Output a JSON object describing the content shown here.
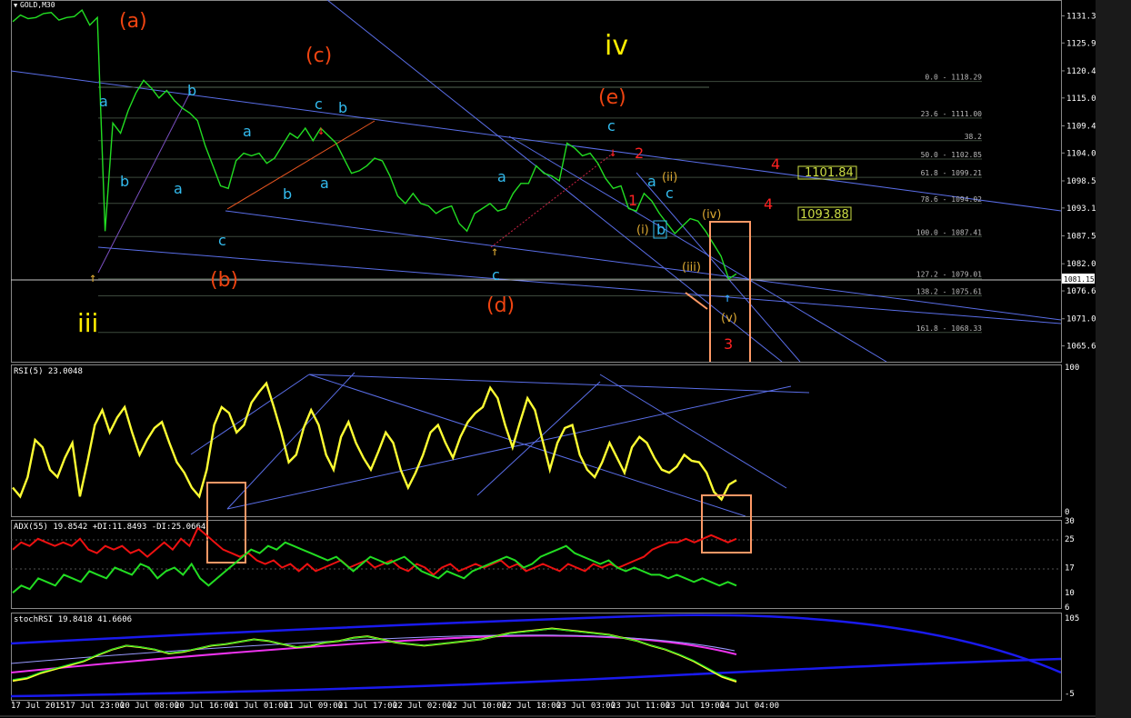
{
  "symbol": "GOLD,M30",
  "colors": {
    "background": "#000000",
    "price": "#22dd22",
    "rsi": "#ffff33",
    "adx": "#ee1111",
    "plus_di": "#22dd22",
    "trend_line": "#5a6ee8",
    "fib_line": "#556655",
    "highlight_box": "#ff9966",
    "wave_cyan": "#33bbee",
    "wave_orange": "#ee4411",
    "wave_yellow": "#ffee00",
    "wave_red": "#ff2222",
    "wave_tan": "#ddaa33"
  },
  "chart_data": [
    {
      "type": "line",
      "panel": "price",
      "title": "GOLD,M30",
      "ylim": [
        1062.5,
        1134.5
      ],
      "y_ticks": [
        "1131.35",
        "1125.95",
        "1120.40",
        "1115.00",
        "1109.45",
        "1104.05",
        "1098.50",
        "1093.10",
        "1087.55",
        "1082.00",
        "1076.60",
        "1071.05",
        "1065.65"
      ],
      "current_price": "1081.15",
      "x_ticks": [
        "17 Jul 2015",
        "17 Jul 23:00",
        "20 Jul 08:00",
        "20 Jul 16:00",
        "21 Jul 01:00",
        "21 Jul 09:00",
        "21 Jul 17:00",
        "22 Jul 02:00",
        "22 Jul 10:00",
        "22 Jul 18:00",
        "23 Jul 03:00",
        "23 Jul 11:00",
        "23 Jul 19:00",
        "24 Jul 04:00"
      ],
      "series": [
        {
          "values": [
            1130.2,
            1131.5,
            1130.8,
            1131.0,
            1131.8,
            1132.0,
            1130.5,
            1131.0,
            1131.2,
            1132.5,
            1129.5,
            1131.0,
            1088.5,
            1110.0,
            1108.0,
            1112.5,
            1116.0,
            1118.5,
            1117.0,
            1115.0,
            1116.5,
            1114.5,
            1113.0,
            1112.0,
            1110.5,
            1105.5,
            1101.5,
            1097.5,
            1097.0,
            1102.5,
            1104.0,
            1103.5,
            1104.0,
            1102.0,
            1103.0,
            1105.5,
            1108.0,
            1107.0,
            1109.0,
            1106.5,
            1109.0,
            1107.5,
            1106.0,
            1103.0,
            1100.0,
            1100.5,
            1101.5,
            1103.0,
            1102.5,
            1099.5,
            1095.5,
            1094.0,
            1096.0,
            1094.0,
            1093.5,
            1092.0,
            1093.0,
            1093.5,
            1090.0,
            1088.5,
            1092.0,
            1093.0,
            1094.0,
            1092.5,
            1093.0,
            1096.0,
            1098.0,
            1098.0,
            1101.5,
            1100.0,
            1099.5,
            1098.5,
            1106.0,
            1105.0,
            1103.5,
            1104.0,
            1102.0,
            1099.0,
            1097.0,
            1097.5,
            1093.0,
            1092.5,
            1096.0,
            1094.5,
            1092.0,
            1090.0,
            1088.0,
            1089.5,
            1091.0,
            1090.5,
            1088.5,
            1086.0,
            1083.5,
            1079.0,
            1080.0
          ]
        }
      ],
      "fib_levels": [
        "0.0 - 1118.29",
        "23.6 - 1111.00",
        "38.2",
        "50.0 - 1102.85",
        "61.8 - 1099.21",
        "78.6 - 1094.02",
        "100.0 - 1087.41",
        "127.2 - 1079.01",
        "138.2 - 1075.61",
        "161.8 - 1068.33"
      ],
      "price_boxes": [
        "1101.84",
        "1093.88"
      ],
      "wave_labels": {
        "orange": [
          "(a)",
          "(c)",
          "(e)",
          "(b)",
          "(d)"
        ],
        "yellow": [
          "iv",
          "iii"
        ],
        "cyan": [
          "a",
          "b",
          "b",
          "c",
          "b",
          "a",
          "a",
          "b",
          "a",
          "c",
          "a",
          "c",
          "b",
          "c",
          "a",
          "c",
          "c",
          "a",
          "b"
        ],
        "red": [
          "2",
          "1",
          "4",
          "4",
          "3"
        ],
        "tan": [
          "(ii)",
          "(i)",
          "(iv)",
          "(iii)",
          "(v)"
        ]
      }
    },
    {
      "type": "line",
      "panel": "rsi",
      "title": "RSI(5) 23.0048",
      "ylim": [
        0,
        100
      ],
      "y_ticks": [
        "100",
        "0"
      ],
      "series": [
        {
          "values": [
            18,
            12,
            25,
            50,
            45,
            30,
            25,
            38,
            48,
            12,
            35,
            60,
            70,
            55,
            65,
            72,
            55,
            40,
            50,
            58,
            62,
            48,
            35,
            28,
            18,
            12,
            30,
            60,
            72,
            68,
            55,
            60,
            75,
            82,
            88,
            72,
            55,
            35,
            40,
            58,
            70,
            60,
            40,
            30,
            52,
            62,
            48,
            38,
            30,
            42,
            55,
            48,
            30,
            18,
            28,
            40,
            55,
            60,
            48,
            38,
            52,
            62,
            68,
            72,
            85,
            78,
            60,
            45,
            62,
            78,
            70,
            50,
            30,
            48,
            58,
            60,
            40,
            30,
            25,
            35,
            48,
            38,
            28,
            45,
            52,
            48,
            38,
            30,
            28,
            32,
            40,
            36,
            35,
            28,
            15,
            10,
            20,
            23
          ]
        }
      ]
    },
    {
      "type": "line",
      "panel": "adx",
      "title": "ADX(55) 19.8542 +DI:11.8493 -DI:25.0664",
      "ylim": [
        6,
        30
      ],
      "y_ticks": [
        "30",
        "25",
        "17",
        "10",
        "6"
      ],
      "series": [
        {
          "name": "ADX",
          "values": [
            22,
            24,
            23,
            25,
            24,
            23,
            24,
            23,
            25,
            22,
            21,
            23,
            22,
            23,
            21,
            22,
            20,
            22,
            24,
            22,
            25,
            23,
            28,
            26,
            24,
            22,
            21,
            20,
            21,
            19,
            18,
            19,
            17,
            18,
            16,
            18,
            16,
            17,
            18,
            19,
            17,
            18,
            19,
            17,
            18,
            19,
            17,
            16,
            18,
            17,
            15,
            17,
            18,
            16,
            17,
            18,
            17,
            18,
            19,
            17,
            18,
            16,
            17,
            18,
            17,
            16,
            18,
            17,
            16,
            18,
            17,
            18,
            17,
            18,
            19,
            20,
            22,
            23,
            24,
            24,
            25,
            24,
            25,
            26,
            25,
            24,
            25
          ]
        },
        {
          "name": "+DI",
          "values": [
            10,
            12,
            11,
            14,
            13,
            12,
            15,
            14,
            13,
            16,
            15,
            14,
            17,
            16,
            15,
            18,
            17,
            14,
            16,
            17,
            15,
            18,
            14,
            12,
            14,
            16,
            18,
            20,
            22,
            21,
            23,
            22,
            24,
            23,
            22,
            21,
            20,
            19,
            20,
            18,
            16,
            18,
            20,
            19,
            18,
            19,
            20,
            18,
            16,
            15,
            14,
            16,
            15,
            14,
            16,
            17,
            18,
            19,
            20,
            19,
            17,
            18,
            20,
            21,
            22,
            23,
            21,
            20,
            19,
            18,
            19,
            17,
            16,
            17,
            16,
            15,
            15,
            14,
            15,
            14,
            13,
            14,
            13,
            12,
            13,
            12
          ]
        }
      ]
    },
    {
      "type": "line",
      "panel": "stochrsi",
      "title": "stochRSI 19.8418 41.6606",
      "ylim": [
        0,
        100
      ],
      "y_ticks": [
        "105",
        "-5"
      ],
      "series": [
        {
          "values": [
            15,
            18,
            25,
            30,
            35,
            40,
            48,
            55,
            60,
            58,
            55,
            50,
            52,
            56,
            60,
            62,
            65,
            68,
            66,
            62,
            58,
            60,
            64,
            66,
            70,
            72,
            68,
            64,
            62,
            60,
            62,
            64,
            66,
            68,
            72,
            76,
            78,
            80,
            82,
            80,
            78,
            76,
            74,
            70,
            66,
            60,
            55,
            48,
            40,
            30,
            20,
            14
          ]
        }
      ]
    }
  ]
}
